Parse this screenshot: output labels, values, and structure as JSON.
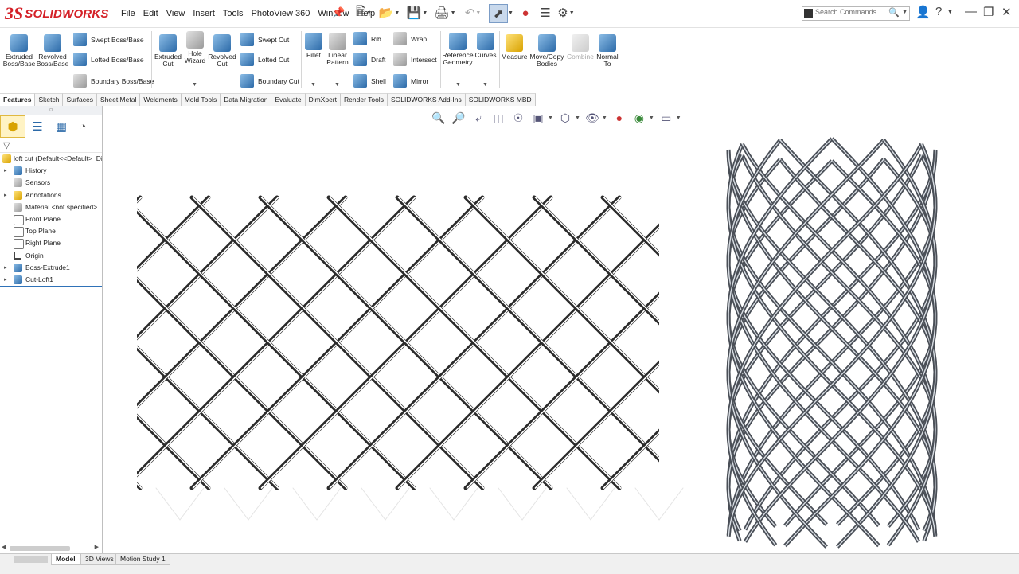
{
  "app": {
    "brand": "SOLIDWORKS",
    "brand_mark": "3S"
  },
  "menu": [
    "File",
    "Edit",
    "View",
    "Insert",
    "Tools",
    "PhotoView 360",
    "Window",
    "Help"
  ],
  "search": {
    "placeholder": "Search Commands"
  },
  "ribbon": {
    "boss": [
      {
        "label": "Extruded\nBoss/Base"
      },
      {
        "label": "Revolved\nBoss/Base"
      }
    ],
    "boss_rows": [
      "Swept Boss/Base",
      "Lofted Boss/Base",
      "Boundary Boss/Base"
    ],
    "cut": [
      {
        "label": "Extruded\nCut"
      },
      {
        "label": "Hole\nWizard"
      },
      {
        "label": "Revolved\nCut"
      }
    ],
    "cut_rows": [
      "Swept Cut",
      "Lofted Cut",
      "Boundary Cut"
    ],
    "fillet": [
      {
        "label": "Fillet"
      },
      {
        "label": "Linear\nPattern"
      }
    ],
    "feature_rows_a": [
      "Rib",
      "Draft",
      "Shell"
    ],
    "feature_rows_b": [
      "Wrap",
      "Intersect",
      "Mirror"
    ],
    "geometry": [
      {
        "label": "Reference\nGeometry"
      },
      {
        "label": "Curves"
      }
    ],
    "tools": [
      {
        "label": "Measure"
      },
      {
        "label": "Move/Copy\nBodies"
      },
      {
        "label": "Combine"
      },
      {
        "label": "Normal\nTo"
      }
    ]
  },
  "tabs": [
    "Features",
    "Sketch",
    "Surfaces",
    "Sheet Metal",
    "Weldments",
    "Mold Tools",
    "Data Migration",
    "Evaluate",
    "DimXpert",
    "Render Tools",
    "SOLIDWORKS Add-Ins",
    "SOLIDWORKS MBD"
  ],
  "tree": {
    "root": "loft cut  (Default<<Default>_Di",
    "items": [
      {
        "label": "History",
        "expand": true
      },
      {
        "label": "Sensors",
        "expand": false
      },
      {
        "label": "Annotations",
        "expand": true
      },
      {
        "label": "Material <not specified>",
        "expand": false
      },
      {
        "label": "Front Plane",
        "expand": false
      },
      {
        "label": "Top Plane",
        "expand": false
      },
      {
        "label": "Right Plane",
        "expand": false
      },
      {
        "label": "Origin",
        "expand": false
      },
      {
        "label": "Boss-Extrude1",
        "expand": true
      },
      {
        "label": "Cut-Loft1",
        "expand": true
      }
    ]
  },
  "bottom_tabs": [
    "Model",
    "3D Views",
    "Motion Study 1"
  ],
  "colors": {
    "accent": "#d42027",
    "lattice": "#2b2b2b",
    "selection": "#2f72b8"
  }
}
